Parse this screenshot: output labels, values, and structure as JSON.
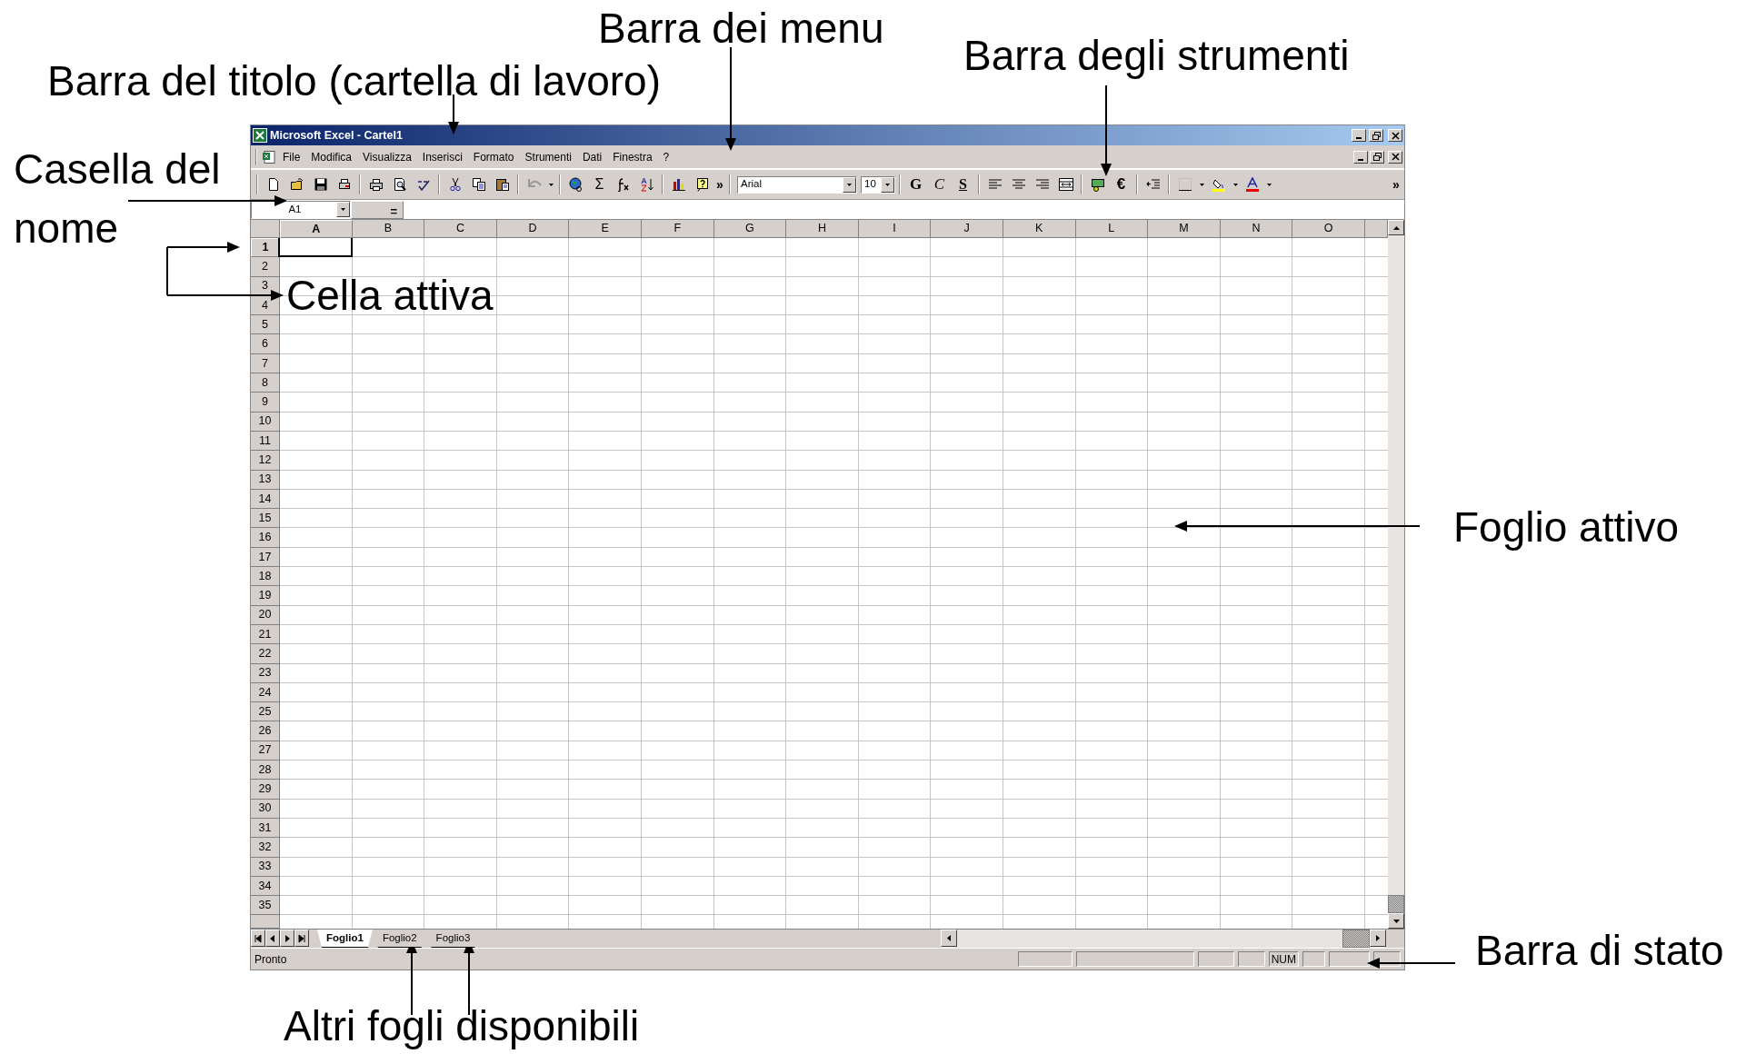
{
  "annotations": [
    {
      "text": "Barra dei menu"
    },
    {
      "text": "Barra del titolo (cartella di lavoro)"
    },
    {
      "text": "Barra degli strumenti"
    },
    {
      "text": "Casella del"
    },
    {
      "text": "nome"
    },
    {
      "text": "Cella attiva"
    },
    {
      "text": "Foglio attivo"
    },
    {
      "text": "Barra di stato"
    },
    {
      "text": "Altri fogli disponibili"
    }
  ],
  "window": {
    "title": "Microsoft Excel - Cartel1"
  },
  "menu": [
    {
      "label": "File"
    },
    {
      "label": "Modifica"
    },
    {
      "label": "Visualizza"
    },
    {
      "label": "Inserisci"
    },
    {
      "label": "Formato"
    },
    {
      "label": "Strumenti"
    },
    {
      "label": "Dati"
    },
    {
      "label": "Finestra"
    },
    {
      "label": "?"
    }
  ],
  "toolbar": {
    "text_buttons": [
      "Σ",
      "»",
      "G",
      "C",
      "S",
      "€",
      "»"
    ],
    "font": "Arial",
    "size": "10"
  },
  "formula_bar": {
    "name_box": "A1",
    "equals": "="
  },
  "grid": {
    "columns": [
      {
        "label": "A",
        "selected": true
      },
      {
        "label": "B",
        "selected": false
      },
      {
        "label": "C",
        "selected": false
      },
      {
        "label": "D",
        "selected": false
      },
      {
        "label": "E",
        "selected": false
      },
      {
        "label": "F",
        "selected": false
      },
      {
        "label": "G",
        "selected": false
      },
      {
        "label": "H",
        "selected": false
      },
      {
        "label": "I",
        "selected": false
      },
      {
        "label": "J",
        "selected": false
      },
      {
        "label": "K",
        "selected": false
      },
      {
        "label": "L",
        "selected": false
      },
      {
        "label": "M",
        "selected": false
      },
      {
        "label": "N",
        "selected": false
      },
      {
        "label": "O",
        "selected": false
      }
    ],
    "rows": [
      {
        "label": "1",
        "selected": true
      },
      {
        "label": "2",
        "selected": false
      },
      {
        "label": "3",
        "selected": false
      },
      {
        "label": "4",
        "selected": false
      },
      {
        "label": "5",
        "selected": false
      },
      {
        "label": "6",
        "selected": false
      },
      {
        "label": "7",
        "selected": false
      },
      {
        "label": "8",
        "selected": false
      },
      {
        "label": "9",
        "selected": false
      },
      {
        "label": "10",
        "selected": false
      },
      {
        "label": "11",
        "selected": false
      },
      {
        "label": "12",
        "selected": false
      },
      {
        "label": "13",
        "selected": false
      },
      {
        "label": "14",
        "selected": false
      },
      {
        "label": "15",
        "selected": false
      },
      {
        "label": "16",
        "selected": false
      },
      {
        "label": "17",
        "selected": false
      },
      {
        "label": "18",
        "selected": false
      },
      {
        "label": "19",
        "selected": false
      },
      {
        "label": "20",
        "selected": false
      },
      {
        "label": "21",
        "selected": false
      },
      {
        "label": "22",
        "selected": false
      },
      {
        "label": "23",
        "selected": false
      },
      {
        "label": "24",
        "selected": false
      },
      {
        "label": "25",
        "selected": false
      },
      {
        "label": "26",
        "selected": false
      },
      {
        "label": "27",
        "selected": false
      },
      {
        "label": "28",
        "selected": false
      },
      {
        "label": "29",
        "selected": false
      },
      {
        "label": "30",
        "selected": false
      },
      {
        "label": "31",
        "selected": false
      },
      {
        "label": "32",
        "selected": false
      },
      {
        "label": "33",
        "selected": false
      },
      {
        "label": "34",
        "selected": false
      },
      {
        "label": "35",
        "selected": false
      }
    ]
  },
  "sheet_tabs": [
    {
      "label": "Foglio1",
      "selected": true
    },
    {
      "label": "Foglio2",
      "selected": false
    },
    {
      "label": "Foglio3",
      "selected": false
    }
  ],
  "status_bar": {
    "text": "Pronto",
    "indicator": "NUM"
  }
}
